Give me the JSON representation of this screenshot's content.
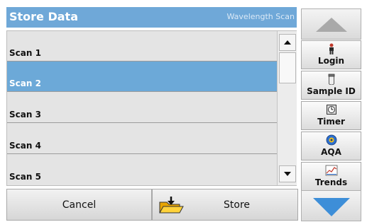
{
  "header": {
    "title": "Store Data",
    "subtitle": "Wavelength Scan"
  },
  "list": {
    "items": [
      {
        "label": "Scan 1",
        "selected": false
      },
      {
        "label": "Scan 2",
        "selected": true
      },
      {
        "label": "Scan 3",
        "selected": false
      },
      {
        "label": "Scan 4",
        "selected": false
      },
      {
        "label": "Scan 5",
        "selected": false
      }
    ],
    "selected_color": "#6ca9d8"
  },
  "footer": {
    "cancel_label": "Cancel",
    "store_label": "Store"
  },
  "sidebar": {
    "buttons": [
      {
        "label": "Login",
        "icon": "person-icon"
      },
      {
        "label": "Sample ID",
        "icon": "sample-vial-icon"
      },
      {
        "label": "Timer",
        "icon": "timer-icon"
      },
      {
        "label": "AQA",
        "icon": "aqa-icon"
      },
      {
        "label": "Trends",
        "icon": "trends-chart-icon"
      }
    ]
  },
  "colors": {
    "header_bg": "#6fa8d8",
    "nav_arrow_up": "#a9a9a9",
    "nav_arrow_down": "#3d8ed8"
  }
}
